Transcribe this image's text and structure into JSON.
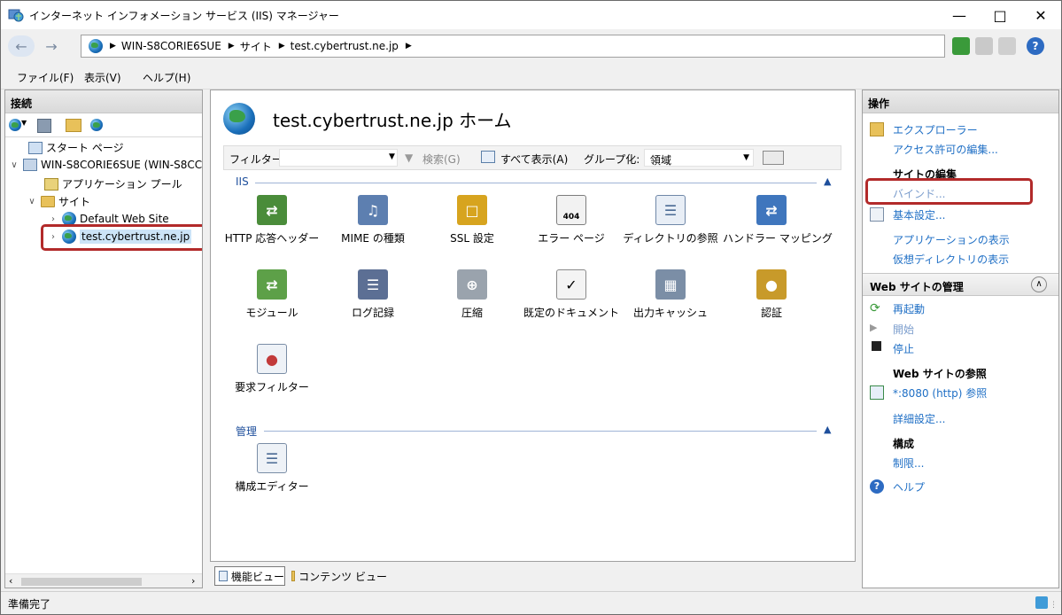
{
  "window": {
    "title": "インターネット インフォメーション サービス (IIS) マネージャー"
  },
  "address": {
    "crumbs": [
      "WIN-S8CORIE6SUE",
      "サイト",
      "test.cybertrust.ne.jp"
    ]
  },
  "menu": {
    "file": "ファイル(F)",
    "view": "表示(V)",
    "help": "ヘルプ(H)"
  },
  "connections": {
    "header": "接続",
    "tree": {
      "start_page": "スタート ページ",
      "server": "WIN-S8CORIE6SUE (WIN-S8CC",
      "app_pools": "アプリケーション プール",
      "sites": "サイト",
      "default_site": "Default Web Site",
      "selected_site": "test.cybertrust.ne.jp"
    }
  },
  "main": {
    "title": "test.cybertrust.ne.jp ホーム",
    "filter_label": "フィルター:",
    "search_label": "検索(G)",
    "show_all_label": "すべて表示(A)",
    "group_label": "グループ化:",
    "group_value": "領域",
    "section_iis": "IIS",
    "section_mgmt": "管理",
    "features": [
      {
        "label": "HTTP 応答ヘッダー",
        "icon": "http-headers-icon"
      },
      {
        "label": "MIME の種類",
        "icon": "mime-types-icon"
      },
      {
        "label": "SSL 設定",
        "icon": "ssl-lock-icon"
      },
      {
        "label": "エラー ページ",
        "icon": "error-pages-icon",
        "badge": "404"
      },
      {
        "label": "ディレクトリの参照",
        "icon": "directory-browsing-icon"
      },
      {
        "label": "ハンドラー マッピング",
        "icon": "handler-mappings-icon"
      },
      {
        "label": "モジュール",
        "icon": "modules-icon"
      },
      {
        "label": "ログ記録",
        "icon": "logging-icon"
      },
      {
        "label": "圧縮",
        "icon": "compression-icon"
      },
      {
        "label": "既定のドキュメント",
        "icon": "default-document-icon"
      },
      {
        "label": "出力キャッシュ",
        "icon": "output-caching-icon"
      },
      {
        "label": "認証",
        "icon": "authentication-icon"
      },
      {
        "label": "要求フィルター",
        "icon": "request-filtering-icon"
      }
    ],
    "mgmt_features": [
      {
        "label": "構成エディター",
        "icon": "config-editor-icon"
      }
    ],
    "tab_features": "機能ビュー",
    "tab_content": "コンテンツ ビュー"
  },
  "actions": {
    "header": "操作",
    "explore": "エクスプローラー",
    "edit_permissions": "アクセス許可の編集...",
    "edit_site_head": "サイトの編集",
    "bindings": "バインド...",
    "basic_settings": "基本設定...",
    "view_apps": "アプリケーションの表示",
    "view_vdirs": "仮想ディレクトリの表示",
    "manage_site_head": "Web サイトの管理",
    "restart": "再起動",
    "start": "開始",
    "stop": "停止",
    "browse_head": "Web サイトの参照",
    "browse_link": "*:8080 (http) 参照",
    "advanced": "詳細設定...",
    "config_head": "構成",
    "limits": "制限...",
    "help": "ヘルプ"
  },
  "status": {
    "text": "準備完了"
  },
  "colors": {
    "link": "#1f6fc5",
    "highlight": "#b22a2a"
  }
}
